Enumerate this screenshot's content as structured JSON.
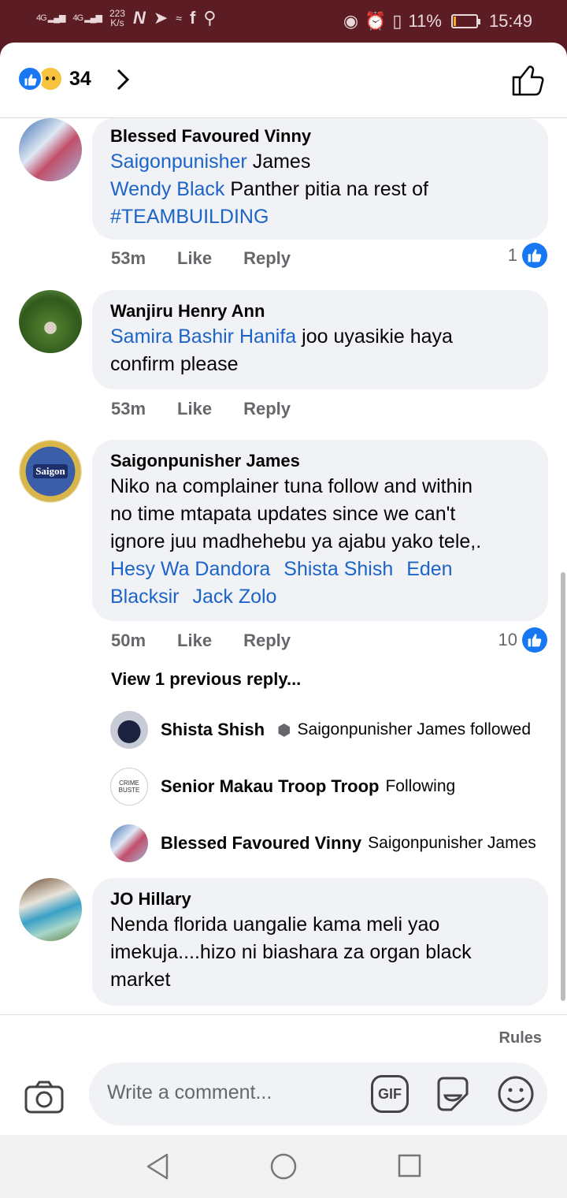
{
  "status_bar": {
    "signal_1": "4G",
    "signal_2": "4G",
    "speed": "223",
    "speed_unit": "K/s",
    "app_icons": [
      "netflix-icon",
      "telegram-icon",
      "wifi-icon",
      "facebook-icon",
      "location-icon"
    ],
    "battery": "11%",
    "time": "15:49"
  },
  "header": {
    "reaction_count": "34",
    "reactions": [
      "like",
      "sad"
    ]
  },
  "comments": [
    {
      "author": "Blessed Favoured Vinny",
      "line1_mention": "Saigonpunisher",
      "line1_text": " James",
      "line2_mention": "Wendy Black",
      "line2_text": " Panther pitia na rest of",
      "line3_mention": "#TEAMBUILDING",
      "time": "53m",
      "like_label": "Like",
      "reply_label": "Reply",
      "likes": "1"
    },
    {
      "author": "Wanjiru Henry Ann",
      "line1_mention": "Samira Bashir Hanifa",
      "line1_text": " joo uyasikie haya",
      "line2_text": "confirm please",
      "time": "53m",
      "like_label": "Like",
      "reply_label": "Reply"
    },
    {
      "author": "Saigonpunisher James",
      "line1_text": "Niko na complainer tuna follow and within",
      "line2_text": "no time mtapata updates since we  can't",
      "line3_text": "ignore juu madhehebu ya ajabu yako tele,.",
      "mention_a": "Hesy Wa Dandora",
      "mention_b": "Shista Shish",
      "mention_c": "Eden",
      "mention_d": "Blacksir",
      "mention_e": "Jack Zolo",
      "time": "50m",
      "like_label": "Like",
      "reply_label": "Reply",
      "likes": "10",
      "view_previous": "View 1 previous reply...",
      "avatar_text": "Saigon",
      "replies": [
        {
          "name": "Shista Shish",
          "text": "Saigonpunisher James followed"
        },
        {
          "name": "Senior Makau Troop Troop",
          "text": "Following",
          "avatar_text_1": "CRIME",
          "avatar_text_2": "BUSTE"
        },
        {
          "name": "Blessed Favoured Vinny",
          "text": "Saigonpunisher James"
        }
      ]
    },
    {
      "author": "JO Hillary",
      "line1_text": "Nenda florida uangalie kama meli yao",
      "line2_text": "imekuja....hizo ni biashara za organ black",
      "line3_text": "market"
    }
  ],
  "composer": {
    "rules": "Rules",
    "placeholder": "Write a comment...",
    "gif_label": "GIF"
  },
  "colors": {
    "status_bar": "#5b1c24",
    "bubble": "#f0f2f5",
    "mention": "#1d64c8",
    "like_blue": "#1877f2"
  }
}
